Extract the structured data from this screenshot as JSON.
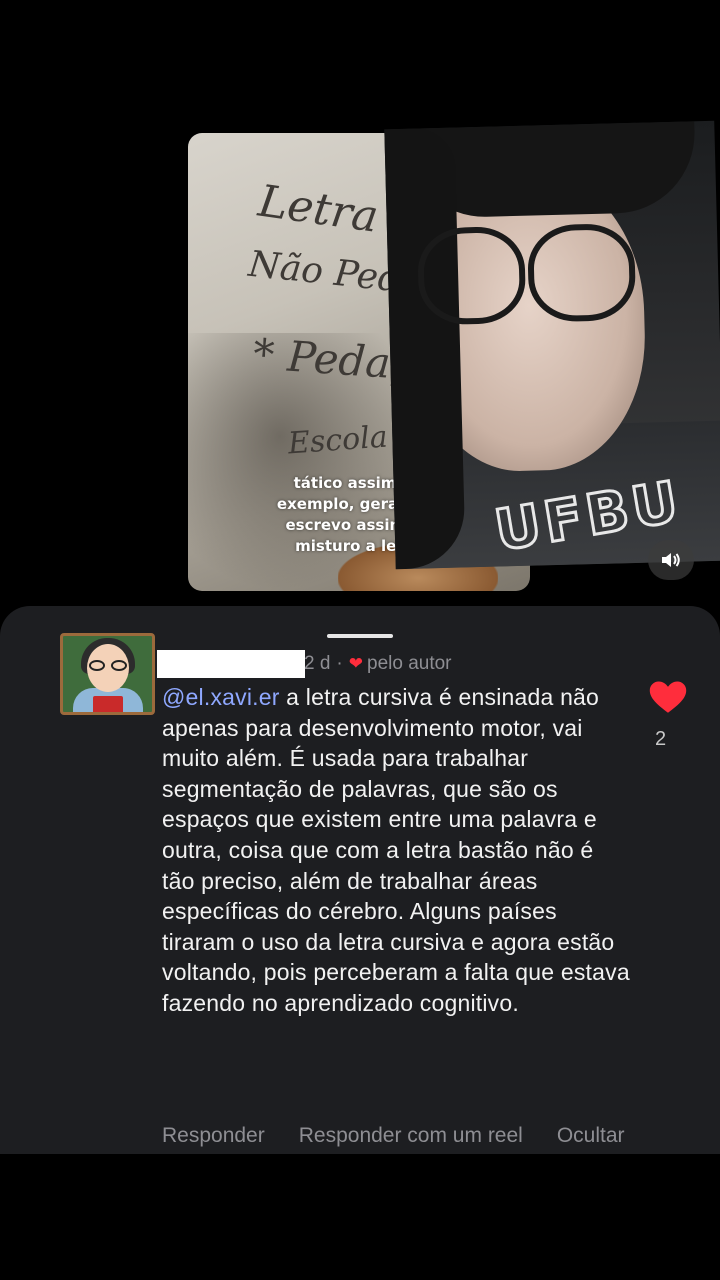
{
  "video": {
    "caption_lines": [
      "tático assim p",
      "exemplo, geralme",
      "escrevo assim e",
      "misturo a letr"
    ],
    "whiteboard_lines": [
      "Letra Ci",
      "Não Pedagógic",
      "* Pedagógic",
      "Escola"
    ]
  },
  "comment": {
    "username": "",
    "meta_time": "2 d",
    "meta_separator": "·",
    "liked_by_author_label": "pelo autor",
    "mention": "@el.xavi.er",
    "body": " a letra cursiva é ensinada não apenas para desenvolvimento motor, vai muito além. É usada para trabalhar segmentação de palavras, que são os espaços que existem entre uma palavra e outra, coisa que com a letra bastão não é tão preciso, além de trabalhar áreas específicas do cérebro. Alguns países tiraram o uso da letra cursiva e agora estão voltando, pois perceberam a falta que estava fazendo no aprendizado cognitivo.",
    "like_count": "2",
    "actions": {
      "reply": "Responder",
      "reply_reel": "Responder com um reel",
      "hide": "Ocultar"
    }
  },
  "colors": {
    "sheet_bg": "#1d1e21",
    "mention": "#8fa8ff",
    "like_red": "#ff2d3c",
    "muted_text": "#8e8e93"
  },
  "icons": [
    "sound-on-icon",
    "heart-icon",
    "liked-by-author-heart-icon"
  ]
}
